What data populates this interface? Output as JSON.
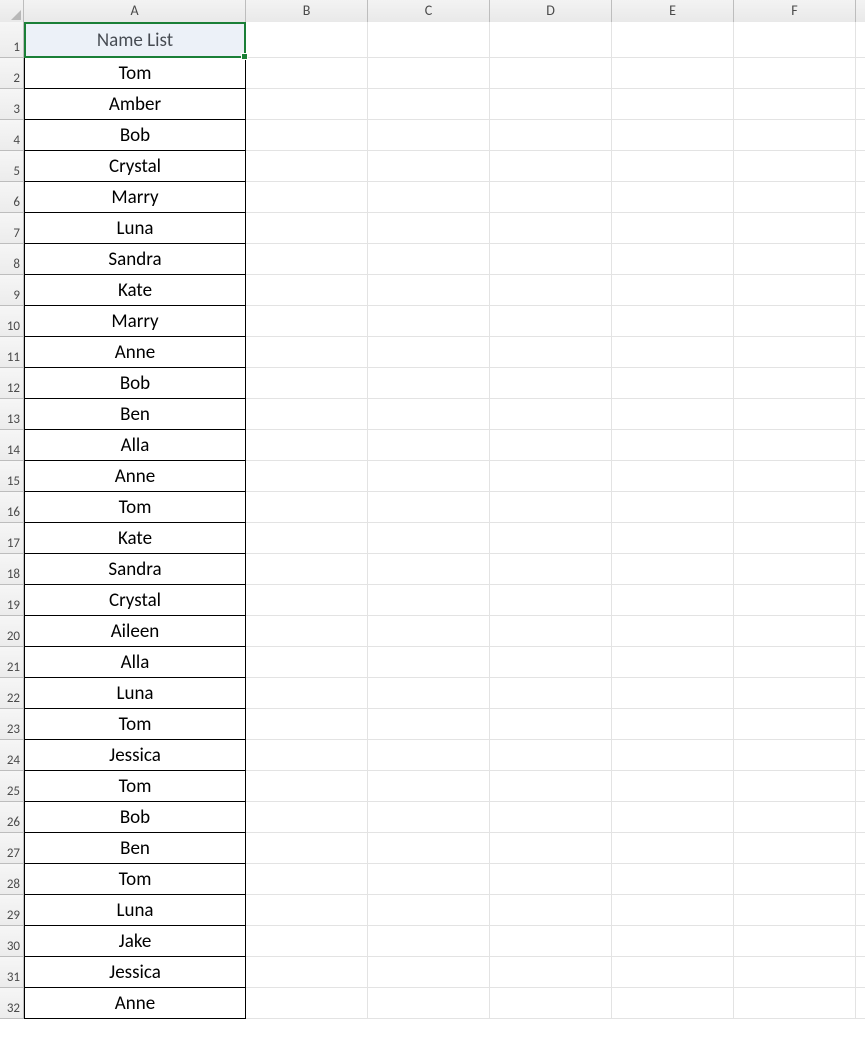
{
  "columns": [
    "A",
    "B",
    "C",
    "D",
    "E",
    "F"
  ],
  "row_numbers": [
    1,
    2,
    3,
    4,
    5,
    6,
    7,
    8,
    9,
    10,
    11,
    12,
    13,
    14,
    15,
    16,
    17,
    18,
    19,
    20,
    21,
    22,
    23,
    24,
    25,
    26,
    27,
    28,
    29,
    30,
    31,
    32
  ],
  "column_a": {
    "header": "Name List",
    "values": [
      "Tom",
      "Amber",
      "Bob",
      "Crystal",
      "Marry",
      "Luna",
      "Sandra",
      "Kate",
      "Marry",
      "Anne",
      "Bob",
      "Ben",
      "Alla",
      "Anne",
      "Tom",
      "Kate",
      "Sandra",
      "Crystal",
      "Aileen",
      "Alla",
      "Luna",
      "Tom",
      "Jessica",
      "Tom",
      "Bob",
      "Ben",
      "Tom",
      "Luna",
      "Jake",
      "Jessica",
      "Anne"
    ]
  },
  "selected_cell": "A1"
}
